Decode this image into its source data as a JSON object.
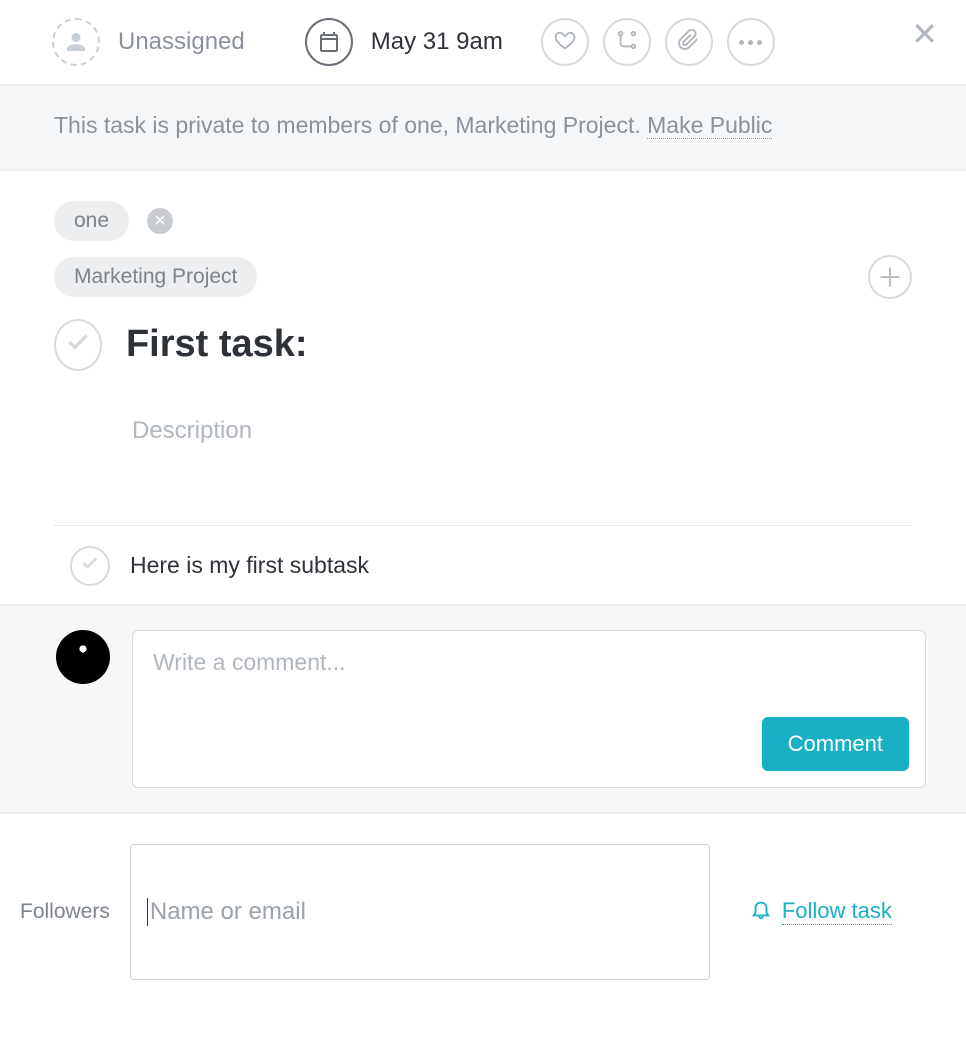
{
  "toolbar": {
    "assignee_label": "Unassigned",
    "due_label": "May 31 9am"
  },
  "privacy": {
    "text_prefix": "This task is private to members of one, Marketing Project.  ",
    "link_label": "Make Public"
  },
  "projects": {
    "tags": [
      "one",
      "Marketing Project"
    ]
  },
  "task": {
    "title": "First task:",
    "description_placeholder": "Description"
  },
  "subtasks": [
    {
      "text": "Here is my first subtask"
    }
  ],
  "comment": {
    "placeholder": "Write a comment...",
    "button_label": "Comment"
  },
  "followers": {
    "section_label": "Followers",
    "input_placeholder": "Name or email",
    "follow_label": "Follow task"
  }
}
